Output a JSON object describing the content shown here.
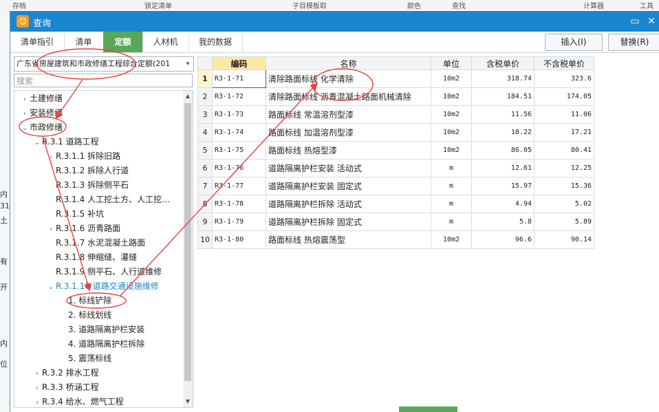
{
  "background": {
    "toolbar_fragments": [
      "存档",
      "锁定清单",
      "子目模板取",
      "颜色",
      "查找",
      "计算器",
      "工具"
    ],
    "left_fragments": [
      "内",
      "31",
      "土",
      "有",
      "开",
      "内",
      "位"
    ]
  },
  "window": {
    "title": "查询",
    "icon": "app-logo-icon",
    "minimize": "▭",
    "close": "✕"
  },
  "tabs": [
    {
      "label": "清单指引",
      "active": false
    },
    {
      "label": "清单",
      "active": false
    },
    {
      "label": "定额",
      "active": true
    },
    {
      "label": "人材机",
      "active": false
    },
    {
      "label": "我的数据",
      "active": false
    }
  ],
  "actions": {
    "insert": "插入(I)",
    "replace": "替换(R)"
  },
  "left": {
    "dropdown_value": "广东省房屋建筑和市政修缮工程综合定额(201",
    "dropdown_arrow": "▾",
    "search_placeholder": "搜索",
    "tree": [
      {
        "label": "土建修缮",
        "exp": "›"
      },
      {
        "label": "安装修缮",
        "exp": "›"
      },
      {
        "label": "市政修缮",
        "exp": "⌄"
      },
      {
        "label": "R.3.1 道路工程",
        "exp": "⌄"
      },
      {
        "label": "R.3.1.1 拆除旧路",
        "exp": "›"
      },
      {
        "label": "R.3.1.2 拆除人行道",
        "exp": ""
      },
      {
        "label": "R.3.1.3 拆除侧平石",
        "exp": ""
      },
      {
        "label": "R.3.1.4 人工挖土方、人工挖…",
        "exp": ""
      },
      {
        "label": "R.3.1.5 补坑",
        "exp": ""
      },
      {
        "label": "R.3.1.6 沥青路面",
        "exp": "›"
      },
      {
        "label": "R.3.1.7 水泥混凝土路面",
        "exp": ""
      },
      {
        "label": "R.3.1.8 伸缩缝、灌缝",
        "exp": ""
      },
      {
        "label": "R.3.1.9 侧平石、人行道维修",
        "exp": ""
      },
      {
        "label": "R.3.1.10 道路交通设施维修",
        "exp": "⌄"
      },
      {
        "label": "1. 标线铲除",
        "exp": ""
      },
      {
        "label": "2. 标线划线",
        "exp": ""
      },
      {
        "label": "3. 道路隔离护栏安装",
        "exp": ""
      },
      {
        "label": "4. 道路隔离护栏拆除",
        "exp": ""
      },
      {
        "label": "5. 震荡标线",
        "exp": ""
      },
      {
        "label": "R.3.2 排水工程",
        "exp": "›"
      },
      {
        "label": "R.3.3 桥涵工程",
        "exp": "›"
      },
      {
        "label": "R.3.4 给水、燃气工程",
        "exp": "›"
      }
    ]
  },
  "table": {
    "headers": [
      "",
      "编码",
      "名称",
      "单位",
      "含税单价",
      "不含税单价"
    ],
    "rows": [
      [
        "1",
        "R3-1-71",
        "清除路面标线 化学清除",
        "10m2",
        "318.74",
        "323.6"
      ],
      [
        "2",
        "R3-1-72",
        "清除路面标线 沥青混凝土路面机械清除",
        "10m2",
        "184.51",
        "174.05"
      ],
      [
        "3",
        "R3-1-73",
        "路面标线 常温溶剂型漆",
        "10m2",
        "11.56",
        "11.06"
      ],
      [
        "4",
        "R3-1-74",
        "路面标线 加温溶剂型漆",
        "10m2",
        "18.22",
        "17.21"
      ],
      [
        "5",
        "R3-1-75",
        "路面标线 热熔型漆",
        "10m2",
        "86.05",
        "80.41"
      ],
      [
        "6",
        "R3-1-76",
        "道路隔离护栏安装 活动式",
        "m",
        "12.61",
        "12.25"
      ],
      [
        "7",
        "R3-1-77",
        "道路隔离护栏安装 固定式",
        "m",
        "15.97",
        "15.36"
      ],
      [
        "8",
        "R3-1-78",
        "道路隔离护栏拆除 活动式",
        "m",
        "4.94",
        "5.02"
      ],
      [
        "9",
        "R3-1-79",
        "道路隔离护栏拆除 固定式",
        "m",
        "5.8",
        "5.89"
      ],
      [
        "10",
        "R3-1-80",
        "路面标线 热熔震荡型",
        "10m2",
        "96.6",
        "90.14"
      ]
    ]
  },
  "colors": {
    "titlebar": "#1a86cf",
    "active_tab": "#58a858",
    "annotation": "#e8413c"
  }
}
